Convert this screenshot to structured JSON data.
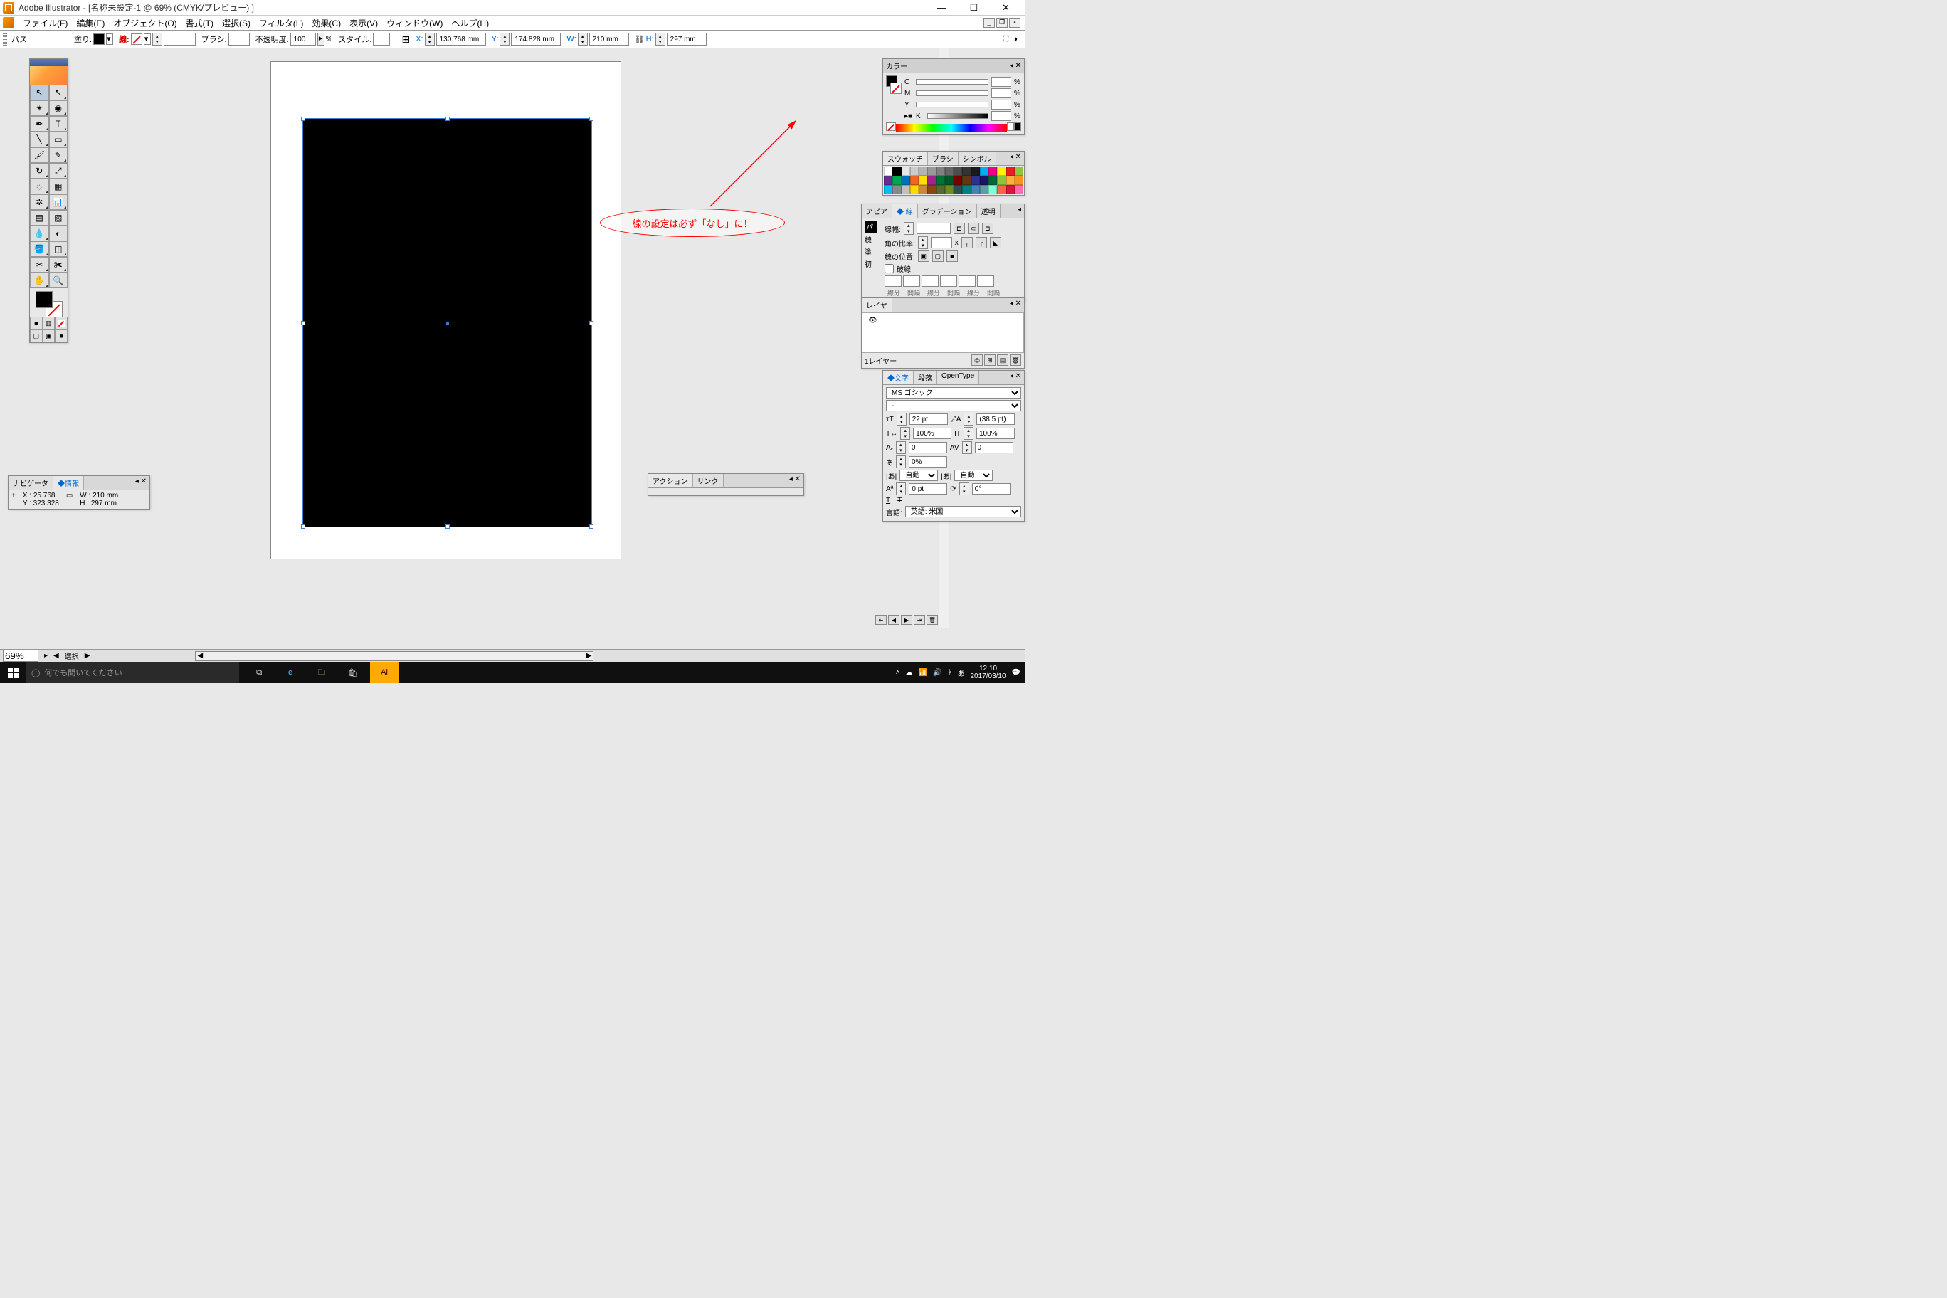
{
  "titlebar": {
    "text": "Adobe Illustrator - [名称未設定-1 @ 69% (CMYK/プレビュー) ]"
  },
  "menu": {
    "file": "ファイル(F)",
    "edit": "編集(E)",
    "object": "オブジェクト(O)",
    "type": "書式(T)",
    "select": "選択(S)",
    "filter": "フィルタ(L)",
    "effect": "効果(C)",
    "view": "表示(V)",
    "window": "ウィンドウ(W)",
    "help": "ヘルプ(H)"
  },
  "optbar": {
    "path_label": "パス",
    "fill_label": "塗り:",
    "stroke_label": "線:",
    "brush_label": "ブラシ:",
    "opacity_label": "不透明度:",
    "opacity_value": "100",
    "opacity_pct": "%",
    "style_label": "スタイル:",
    "x_label": "X:",
    "x_value": "130.768 mm",
    "y_label": "Y:",
    "y_value": "174.828 mm",
    "w_label": "W:",
    "w_value": "210 mm",
    "h_label": "H:",
    "h_value": "297 mm"
  },
  "color_panel": {
    "title": "カラー",
    "c": "C",
    "m": "M",
    "y": "Y",
    "k": "K",
    "pct": "%"
  },
  "swatch_panel": {
    "tab1": "スウォッチ",
    "tab2": "ブラシ",
    "tab3": "シンボル",
    "colors": [
      "#ffffff",
      "#000000",
      "#e6e6e6",
      "#cccccc",
      "#b3b3b3",
      "#999999",
      "#808080",
      "#666666",
      "#4d4d4d",
      "#333333",
      "#1a1a1a",
      "#00aeef",
      "#ec008c",
      "#fff200",
      "#ed1c24",
      "#8dc63f",
      "#662d91",
      "#00a651",
      "#0072bc",
      "#f26522",
      "#ffde00",
      "#a3238e",
      "#007236",
      "#005826",
      "#790000",
      "#603913",
      "#2e3192",
      "#1b1464",
      "#006837",
      "#8cc63f",
      "#fbb040",
      "#f7941e",
      "#00bff3",
      "#898989",
      "#c0c0c0",
      "#ffd700",
      "#cd853f",
      "#8b4513",
      "#556b2f",
      "#6b8e23",
      "#2f4f4f",
      "#008080",
      "#4682b4",
      "#5f9ea0",
      "#7fffd4",
      "#ff6347",
      "#dc143c",
      "#ff69b4"
    ]
  },
  "appearance_panel": {
    "tab1": "アピア",
    "tab2": "線",
    "tab3": "グラデーション",
    "tab4": "透明",
    "row_line": "線",
    "row_fill": "塗",
    "row_init": "初",
    "line_label": "パ",
    "stroke_width_label": "線幅:",
    "corner_label": "角の比率:",
    "pos_label": "線の位置:",
    "dash_label": "破線",
    "col_a": "線分",
    "col_b": "間隔",
    "x_sym": "x"
  },
  "layers_panel": {
    "tab": "レイヤ",
    "layer1": "1レイヤー"
  },
  "char_panel": {
    "tab1": "文字",
    "tab2": "段落",
    "tab3": "OpenType",
    "font": "MS ゴシック",
    "style": "-",
    "size": "22 pt",
    "leading": "(38.5 pt)",
    "hscale": "100%",
    "vscale": "100%",
    "tracking": "0",
    "kerning": "0",
    "baseline": "0%",
    "auto": "自動",
    "shift": "0 pt",
    "rotate": "0°",
    "lang_label": "言語:",
    "lang_val": "英語: 米国"
  },
  "actions_panel": {
    "tab1": "アクション",
    "tab2": "リンク"
  },
  "info_panel": {
    "tab1": "ナビゲータ",
    "tab2": "情報",
    "x_lbl": "X :",
    "x_val": "25.768",
    "y_lbl": "Y :",
    "y_val": "323.328",
    "w_lbl": "W :",
    "w_val": "210 mm",
    "h_lbl": "H :",
    "h_val": "297 mm"
  },
  "status": {
    "zoom": "69%",
    "sel": "選択"
  },
  "annotation": {
    "text": "線の設定は必ず「なし」に！"
  },
  "taskbar": {
    "search_placeholder": "何でも聞いてください",
    "ime": "あ",
    "time": "12:10",
    "date": "2017/03/10"
  }
}
